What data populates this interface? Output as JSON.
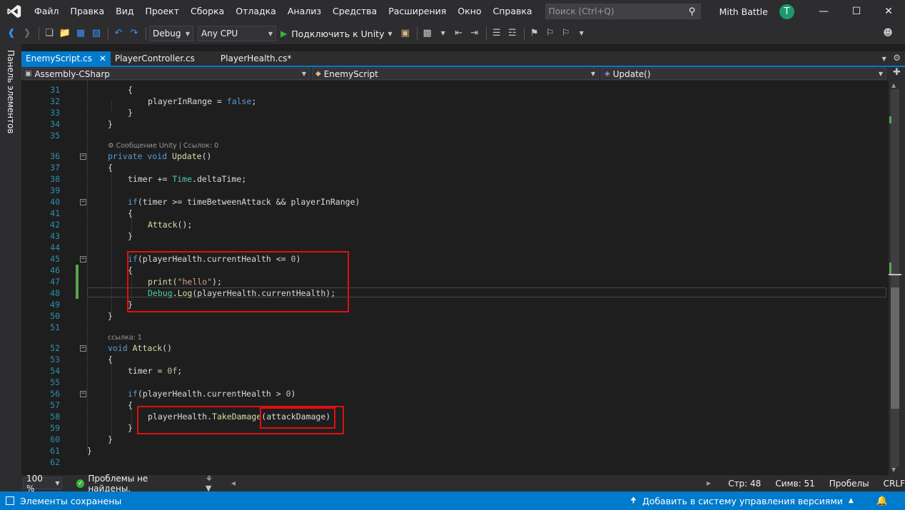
{
  "menu": {
    "items": [
      "Файл",
      "Правка",
      "Вид",
      "Проект",
      "Сборка",
      "Отладка",
      "Анализ",
      "Средства",
      "Расширения",
      "Окно",
      "Справка"
    ],
    "search_placeholder": "Поиск (Ctrl+Q)",
    "solution_name": "Mith Battle",
    "user_initial": "T"
  },
  "toolbar": {
    "configuration": "Debug",
    "platform": "Any CPU",
    "run_label": "Подключить к Unity"
  },
  "side_panel": {
    "label": "Панель элементов"
  },
  "tabs": [
    {
      "label": "EnemyScript.cs",
      "active": true
    },
    {
      "label": "PlayerController.cs",
      "active": false
    },
    {
      "label": "PlayerHealth.cs*",
      "active": false
    }
  ],
  "navbar": {
    "project": "Assembly-CSharp",
    "type": "EnemyScript",
    "member": "Update()"
  },
  "code": {
    "codelens_update": "Сообщение Unity | Ссылок: 0",
    "codelens_attack": "ссылка: 1",
    "lines": [
      {
        "n": "31",
        "text": "{"
      },
      {
        "n": "32",
        "text": "playerInRange = false;"
      },
      {
        "n": "33",
        "text": "}"
      },
      {
        "n": "34",
        "text": "}"
      },
      {
        "n": "35",
        "text": ""
      },
      {
        "n": "36",
        "text": "private void Update()"
      },
      {
        "n": "37",
        "text": "{"
      },
      {
        "n": "38",
        "text": "timer += Time.deltaTime;"
      },
      {
        "n": "39",
        "text": ""
      },
      {
        "n": "40",
        "text": "if(timer >= timeBetweenAttack && playerInRange)"
      },
      {
        "n": "41",
        "text": "{"
      },
      {
        "n": "42",
        "text": "Attack();"
      },
      {
        "n": "43",
        "text": "}"
      },
      {
        "n": "44",
        "text": ""
      },
      {
        "n": "45",
        "text": "if(playerHealth.currentHealth <= 0)"
      },
      {
        "n": "46",
        "text": "{"
      },
      {
        "n": "47",
        "text": "print(\"hello\");"
      },
      {
        "n": "48",
        "text": "Debug.Log(playerHealth.currentHealth);"
      },
      {
        "n": "49",
        "text": "}"
      },
      {
        "n": "50",
        "text": "}"
      },
      {
        "n": "51",
        "text": ""
      },
      {
        "n": "52",
        "text": "void Attack()"
      },
      {
        "n": "53",
        "text": "{"
      },
      {
        "n": "54",
        "text": "timer = 0f;"
      },
      {
        "n": "55",
        "text": ""
      },
      {
        "n": "56",
        "text": "if(playerHealth.currentHealth > 0)"
      },
      {
        "n": "57",
        "text": "{"
      },
      {
        "n": "58",
        "text": "playerHealth.TakeDamage(attackDamage)"
      },
      {
        "n": "59",
        "text": "}"
      },
      {
        "n": "60",
        "text": "}"
      },
      {
        "n": "61",
        "text": "}"
      },
      {
        "n": "62",
        "text": ""
      }
    ]
  },
  "editor_status": {
    "zoom": "100 %",
    "problems": "Проблемы не найдены.",
    "line": "Стр: 48",
    "col": "Симв: 51",
    "whitespace": "Пробелы",
    "eol": "CRLF"
  },
  "statusbar": {
    "saved": "Элементы сохранены",
    "source_control": "Добавить в систему управления версиями"
  },
  "colors": {
    "accent": "#007acc",
    "highlight_box": "#e01010",
    "line_numbers": "#2b91af"
  }
}
